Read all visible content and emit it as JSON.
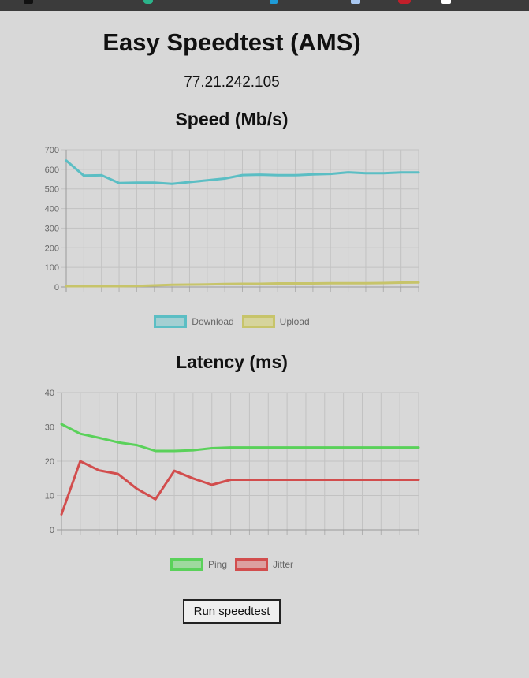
{
  "page": {
    "title": "Easy Speedtest (AMS)",
    "ip": "77.21.242.105",
    "run_button": "Run speedtest"
  },
  "speed": {
    "title": "Speed (Mb/s)",
    "legend": [
      {
        "label": "Download",
        "color": "#5bbec4",
        "fill": "#a3cfd2"
      },
      {
        "label": "Upload",
        "color": "#c7c46a",
        "fill": "#d6d49c"
      }
    ]
  },
  "latency": {
    "title": "Latency (ms)",
    "legend": [
      {
        "label": "Ping",
        "color": "#5ad15a",
        "fill": "#9ed99e"
      },
      {
        "label": "Jitter",
        "color": "#d24d4d",
        "fill": "#dca0a0"
      }
    ]
  },
  "chart_data": [
    {
      "type": "line",
      "title": "Speed (Mb/s)",
      "x": [
        0,
        1,
        2,
        3,
        4,
        5,
        6,
        7,
        8,
        9,
        10,
        11,
        12,
        13,
        14,
        15,
        16,
        17,
        18,
        19,
        20
      ],
      "ylim": [
        0,
        700
      ],
      "yticks": [
        0,
        100,
        200,
        300,
        400,
        500,
        600,
        700
      ],
      "grid": true,
      "legend_position": "bottom",
      "series": [
        {
          "name": "Download",
          "values": [
            645,
            568,
            570,
            530,
            532,
            532,
            526,
            535,
            544,
            553,
            571,
            573,
            570,
            570,
            574,
            577,
            585,
            580,
            580,
            584,
            584
          ]
        },
        {
          "name": "Upload",
          "values": [
            4,
            4,
            4,
            4,
            5,
            8,
            11,
            12,
            13,
            15,
            16,
            16,
            18,
            18,
            18,
            19,
            19,
            19,
            20,
            22,
            23
          ]
        }
      ]
    },
    {
      "type": "line",
      "title": "Latency (ms)",
      "x": [
        0,
        1,
        2,
        3,
        4,
        5,
        6,
        7,
        8,
        9,
        10,
        11,
        12,
        13,
        14,
        15,
        16,
        17,
        18,
        19
      ],
      "ylim": [
        0,
        40
      ],
      "yticks": [
        0,
        10,
        20,
        30,
        40
      ],
      "grid": true,
      "legend_position": "bottom",
      "series": [
        {
          "name": "Ping",
          "values": [
            30.8,
            28.0,
            26.8,
            25.5,
            24.7,
            23.0,
            23.0,
            23.2,
            23.8,
            24.0,
            24.0,
            24.0,
            24.0,
            24.0,
            24.0,
            24.0,
            24.0,
            24.0,
            24.0,
            24.0
          ]
        },
        {
          "name": "Jitter",
          "values": [
            4.5,
            20.0,
            17.3,
            16.3,
            12.0,
            8.9,
            17.2,
            15.0,
            13.1,
            14.6,
            14.6,
            14.6,
            14.6,
            14.6,
            14.6,
            14.6,
            14.6,
            14.6,
            14.6,
            14.6
          ]
        }
      ]
    }
  ]
}
